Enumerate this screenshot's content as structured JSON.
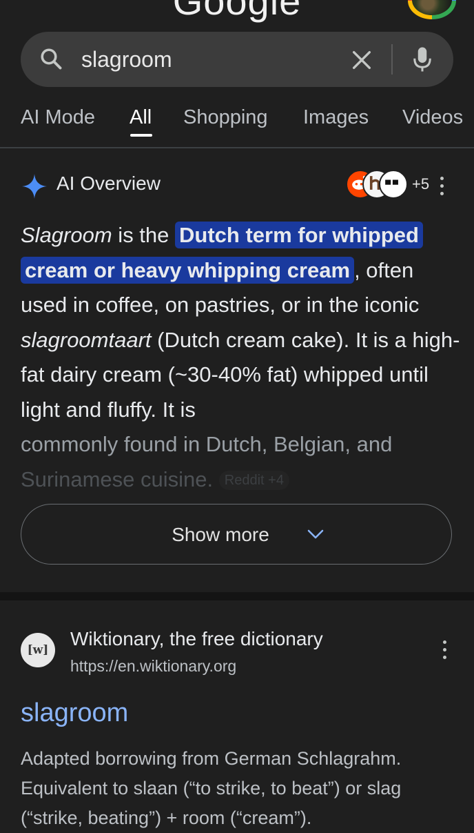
{
  "header": {
    "logo_text": "Google"
  },
  "search": {
    "query": "slagroom"
  },
  "tabs": [
    {
      "label": "AI Mode",
      "active": false
    },
    {
      "label": "All",
      "active": true
    },
    {
      "label": "Shopping",
      "active": false
    },
    {
      "label": "Images",
      "active": false
    },
    {
      "label": "Videos",
      "active": false
    }
  ],
  "ai_overview": {
    "title": "AI Overview",
    "source_count": "+5",
    "body": {
      "term": "Slagroom",
      "p1": " is the ",
      "hl1": "Dutch term for whipped",
      "hl2": "cream or heavy whipping cream",
      "p2": ", often used in coffee, on pastries, or in the iconic ",
      "term2": "slagroomtaart",
      "p3": " (Dutch cream cake). It is a high-fat dairy cream (~30-40% fat) whipped until light and fluffy. It is ",
      "p4": "commonly found in Dutch, Belgian, and",
      "p5": "Surinamese cuisine.",
      "chip": "Reddit +4"
    },
    "show_more": "Show more"
  },
  "result": {
    "favicon_text": "[w]",
    "site_name": "Wiktionary, the free dictionary",
    "url": "https://en.wiktionary.org",
    "title": "slagroom",
    "snippet": "Adapted borrowing from German Schlagrahm. Equivalent to slaan (“to strike, to beat”) or slag (“strike, beating”) + room (“cream”)."
  },
  "colors": {
    "background": "#1f1f1f",
    "search_bar": "#3c3c3c",
    "highlight": "#1a3a9e",
    "link": "#8ab4f8",
    "spark": "#4c8df6"
  },
  "icons": [
    "search-icon",
    "clear-icon",
    "mic-icon",
    "ai-spark-icon",
    "reddit-icon",
    "kebab-menu-icon",
    "chevron-down-icon",
    "wiktionary-favicon"
  ]
}
